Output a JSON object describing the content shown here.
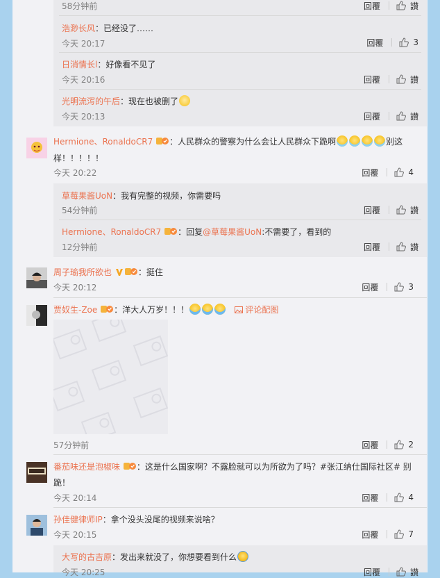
{
  "labels": {
    "reply": "回覆",
    "like": "讃",
    "reply_prefix": "回复",
    "view_pic": "评论配图"
  },
  "top_time": "58分钟前",
  "sub1": [
    {
      "user": "浩渺长风",
      "text": "：已经没了……",
      "time": "今天 20:17",
      "likes": "3"
    },
    {
      "user": "日消情长l",
      "text": "：好像看不见了",
      "time": "今天 20:16",
      "likes": ""
    },
    {
      "user": "光明流泻的午后",
      "text": "：现在也被删了",
      "time": "今天 20:13",
      "likes": ""
    }
  ],
  "c1": {
    "user": "Hermione、RonaldoCR7",
    "text": "：人民群众的警察为什么会让人民群众下跪啊",
    "text2": "别这",
    "line2": "样！！！！！",
    "time": "今天 20:22",
    "likes": "4"
  },
  "sub2": [
    {
      "user": "草莓果酱UoN",
      "text": "：我有完整的视频，你需要吗",
      "time": "54分钟前",
      "likes": ""
    },
    {
      "user": "Hermione、RonaldoCR7",
      "mention": "@草莓果酱UoN",
      "text": ":不需要了，看到的",
      "time": "12分钟前",
      "likes": ""
    }
  ],
  "c2": {
    "user": "周子瑜我所欲也",
    "text": "：挺住",
    "time": "今天 20:12",
    "likes": "3"
  },
  "c3": {
    "user": "贾奴生-Zoe",
    "text": "：洋大人万岁！！！",
    "time": "57分钟前",
    "likes": "2"
  },
  "c4": {
    "user": "番茄味还是泡椒味",
    "text": "：这是什么国家啊？不露脸就可以为所欲为了吗？#张江纳仕国际社区# 别",
    "line2": "跪！",
    "time": "今天 20:14",
    "likes": "4"
  },
  "c5": {
    "user": "孙佳健律师IP",
    "text": "：拿个没头没尾的视频来说啥？",
    "time": "今天 20:15",
    "likes": "7"
  },
  "sub3": [
    {
      "user": "大写的古吉原",
      "text": "：发出来就没了，你想要看到什么",
      "time": "今天 20:25",
      "likes": ""
    }
  ],
  "colors": {
    "username": "#eb7350",
    "panel": "#f2f2f5",
    "sub_bg": "#e9e9ec",
    "bg": "#a9d2ee"
  }
}
